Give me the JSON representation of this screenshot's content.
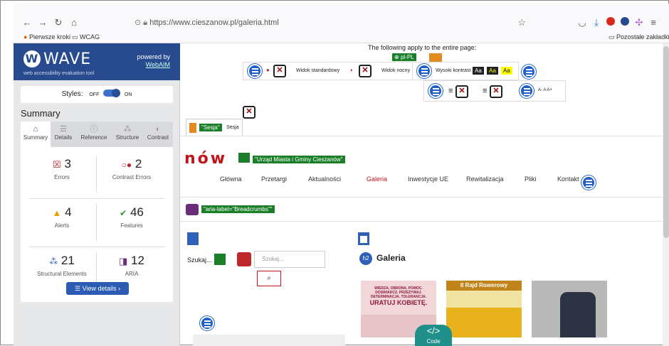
{
  "browser": {
    "url": "https://www.cieszanow.pl/galeria.html",
    "bookmarks": [
      "Pierwsze kroki",
      "WCAG"
    ],
    "other_bookmarks": "Pozostałe zakładki"
  },
  "wave": {
    "title": "WAVE",
    "tagline": "web accessibility evaluation tool",
    "powered_by": "powered by",
    "webaim": "WebAIM",
    "styles_label": "Styles:",
    "off": "OFF",
    "on": "ON",
    "summary_title": "Summary",
    "tabs": [
      "Summary",
      "Details",
      "Reference",
      "Structure",
      "Contrast"
    ],
    "cards": [
      {
        "num": "3",
        "label": "Errors",
        "color": "#c0272d"
      },
      {
        "num": "2",
        "label": "Contrast Errors",
        "color": "#c0272d"
      },
      {
        "num": "4",
        "label": "Alerts",
        "color": "#e5a100"
      },
      {
        "num": "46",
        "label": "Features",
        "color": "#2f8f3a"
      },
      {
        "num": "21",
        "label": "Structural Elements",
        "color": "#2f61b8"
      },
      {
        "num": "12",
        "label": "ARIA",
        "color": "#6b2d7a"
      }
    ],
    "view_details": "View details ›"
  },
  "site": {
    "entire_page_note": "The following apply to the entire page:",
    "lang_tag": "pl-PL",
    "widok_standardowy": "Widok standardowy",
    "widok_nocny": "Widok nocny",
    "wysoki_kontrast": "Wysoki kontrast",
    "aa": "Aa",
    "font_size": "A- A A+",
    "sesja_tag": "\"Sesja\"",
    "sesja": "Sesja",
    "logo_partial": "nów",
    "alt_tag": "\"Urząd Miasta i Gminy Cieszanów\"",
    "menu": [
      "Główna",
      "Przetargi",
      "Aktualności",
      "Galeria",
      "Inwestycje UE",
      "Rewitalizacja",
      "Pliki",
      "Kontakt"
    ],
    "breadcrumbs_tag": "\"aria-label=\"Breadcrumbs\"\"",
    "search_label": "Szukaj...",
    "search_placeholder": "Szukaj...",
    "h2": "Galeria",
    "h2_tag": "h2",
    "code_label": "Code",
    "poster1": [
      "WIEDZA, OBRONA, POMOC.",
      "DOSWIADCZ. PRZEŻYWAJ.",
      "DETERMINACJA. TOLERANCJA.",
      "URATUJ KOBIETĘ."
    ],
    "poster2": "II Rajd Rowerowy"
  }
}
